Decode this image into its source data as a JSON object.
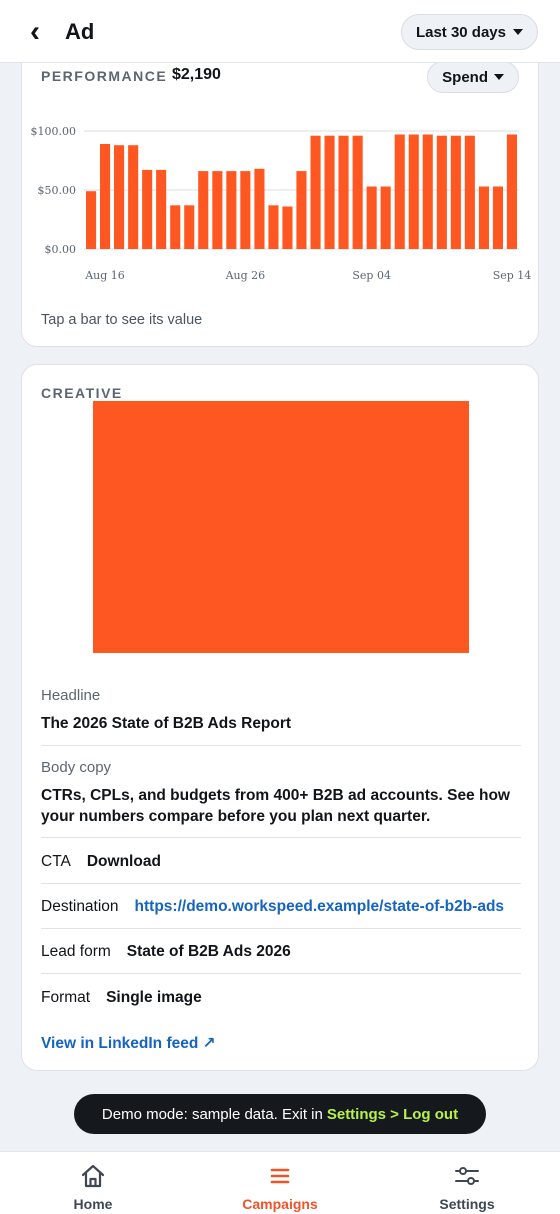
{
  "header": {
    "back_glyph": "‹",
    "title": "Ad",
    "range_label": "Last 30 days"
  },
  "performance": {
    "label": "PERFORMANCE",
    "total": "$2,190",
    "metric_label": "Spend",
    "hint": "Tap a bar to see its value",
    "accent": "#ff5722"
  },
  "chart_data": {
    "type": "bar",
    "title": "",
    "xlabel": "",
    "ylabel": "",
    "ylim": [
      0,
      100
    ],
    "y_ticks": [
      "$0.00",
      "$50.00",
      "$100.00"
    ],
    "x_tick_labels": [
      {
        "index": 1,
        "label": "Aug 16"
      },
      {
        "index": 11,
        "label": "Aug 26"
      },
      {
        "index": 20,
        "label": "Sep 04"
      },
      {
        "index": 30,
        "label": "Sep 14"
      }
    ],
    "categories": [
      "Aug 15",
      "Aug 16",
      "Aug 17",
      "Aug 18",
      "Aug 19",
      "Aug 20",
      "Aug 21",
      "Aug 22",
      "Aug 23",
      "Aug 24",
      "Aug 25",
      "Aug 26",
      "Aug 27",
      "Aug 28",
      "Aug 29",
      "Aug 30",
      "Aug 31",
      "Sep 01",
      "Sep 02",
      "Sep 03",
      "Sep 04",
      "Sep 05",
      "Sep 06",
      "Sep 07",
      "Sep 08",
      "Sep 09",
      "Sep 10",
      "Sep 11",
      "Sep 12",
      "Sep 13",
      "Sep 14"
    ],
    "values": [
      49,
      89,
      88,
      88,
      67,
      67,
      37,
      37,
      66,
      66,
      66,
      66,
      68,
      37,
      36,
      66,
      96,
      96,
      96,
      96,
      53,
      53,
      97,
      97,
      97,
      96,
      96,
      96,
      53,
      53,
      97
    ],
    "grid": true
  },
  "creative": {
    "label": "CREATIVE",
    "image_color": "#ff5722",
    "headline_label": "Headline",
    "headline": "The 2026 State of B2B Ads Report",
    "body_label": "Body copy",
    "body": "CTRs, CPLs, and budgets from 400+ B2B ad accounts. See how your numbers compare before you plan next quarter.",
    "cta_label": "CTA",
    "cta": "Download",
    "destination_label": "Destination",
    "destination": "https://demo.workspeed.example/state-of-b2b-ads",
    "lead_form_label": "Lead form",
    "lead_form": "State of B2B Ads 2026",
    "format_label": "Format",
    "format": "Single image",
    "view_link": "View in LinkedIn feed ↗"
  },
  "toast": {
    "text": "Demo mode: sample data. Exit in",
    "action": "Settings > Log out"
  },
  "nav": {
    "items": [
      {
        "label": "Home",
        "icon": "home-icon"
      },
      {
        "label": "Campaigns",
        "icon": "list-icon",
        "active": true
      },
      {
        "label": "Settings",
        "icon": "sliders-icon"
      }
    ],
    "active_color": "#f0532a"
  }
}
